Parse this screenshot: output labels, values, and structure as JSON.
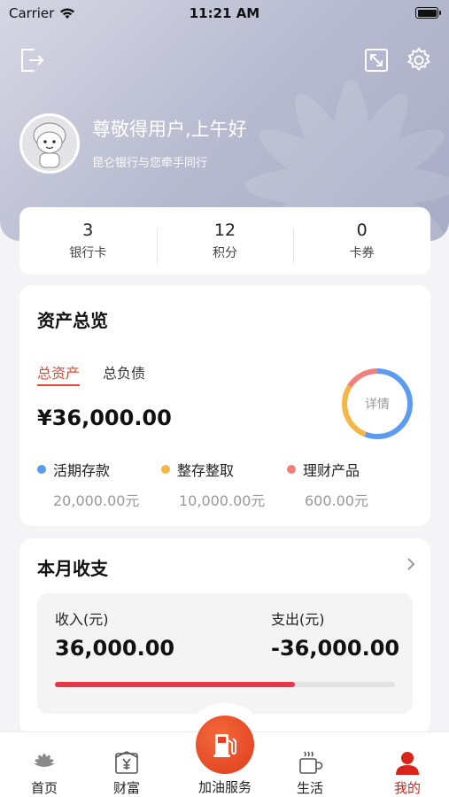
{
  "status_bar": {
    "carrier": "Carrier",
    "time": "11:21 AM"
  },
  "header": {
    "greeting": "尊敬得用户,上午好",
    "sub_greeting": "昆仑银行与您牵手同行"
  },
  "stats": [
    {
      "value": "3",
      "label": "银行卡"
    },
    {
      "value": "12",
      "label": "积分"
    },
    {
      "value": "0",
      "label": "卡券"
    }
  ],
  "assets": {
    "title": "资产总览",
    "tabs": {
      "active": "总资产",
      "inactive": "总负债"
    },
    "total": "¥36,000.00",
    "details_label": "详情",
    "legend": [
      {
        "name": "活期存款",
        "value": "20,000.00元",
        "color": "#5b9bf0"
      },
      {
        "name": "整存整取",
        "value": "10,000.00元",
        "color": "#f5b547"
      },
      {
        "name": "理财产品",
        "value": "600.00元",
        "color": "#f2807a"
      }
    ]
  },
  "monthly": {
    "title": "本月收支",
    "income_label": "收入(元)",
    "income_value": "36,000.00",
    "expense_label": "支出(元)",
    "expense_value": "-36,000.00",
    "progress_fraction": 0.705,
    "accent": "#e8364a"
  },
  "tabbar": {
    "items": [
      {
        "label": "首页",
        "icon": "petrochina-logo-icon"
      },
      {
        "label": "财富",
        "icon": "wealth-icon"
      },
      {
        "label": "加油服务",
        "icon": "fuel-pump-icon"
      },
      {
        "label": "生活",
        "icon": "coffee-icon"
      },
      {
        "label": "我的",
        "icon": "user-icon"
      }
    ],
    "active_color": "#d8241c"
  }
}
